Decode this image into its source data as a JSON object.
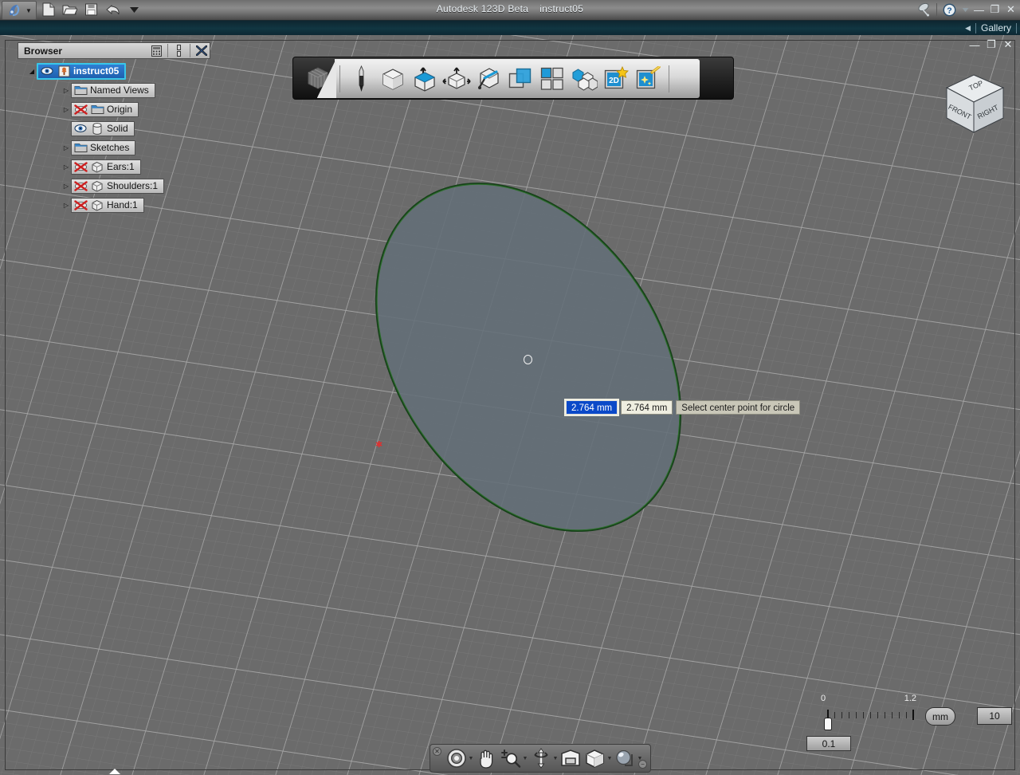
{
  "titlebar": {
    "app_title": "Autodesk 123D Beta",
    "document_name": "instruct05",
    "app_menu_icon": "app-logo-icon",
    "quick_access": [
      {
        "name": "new-document-icon",
        "label": "New"
      },
      {
        "name": "open-document-icon",
        "label": "Open"
      },
      {
        "name": "save-document-icon",
        "label": "Save"
      },
      {
        "name": "undo-icon",
        "label": "Undo"
      },
      {
        "name": "quick-access-more-icon",
        "label": "Customize"
      }
    ],
    "right_icons": [
      {
        "name": "satellite-dish-icon",
        "label": "Connect"
      },
      {
        "name": "help-icon",
        "label": "Help"
      },
      {
        "name": "help-dropdown-icon",
        "label": "Help options"
      }
    ],
    "window_controls": {
      "minimize": "—",
      "maximize": "❐",
      "close": "✕"
    }
  },
  "gallery_bar": {
    "arrow": "◀",
    "label": "Gallery"
  },
  "document_window_controls": {
    "minimize": "—",
    "restore": "❐",
    "close": "✕"
  },
  "browser": {
    "title": "Browser",
    "header_buttons": [
      {
        "name": "browser-grid-view-button",
        "glyph": "▒"
      },
      {
        "name": "browser-options-button",
        "glyph": "⋮"
      },
      {
        "name": "browser-close-button",
        "glyph": "✕"
      }
    ],
    "tree": [
      {
        "label": "instruct05",
        "selected": true,
        "twisty": "◢",
        "icons": [
          "eye-icon",
          "document-pin-icon"
        ],
        "indent": 0
      },
      {
        "label": "Named Views",
        "selected": false,
        "twisty": "▷",
        "icons": [
          "folder-icon"
        ],
        "indent": 1
      },
      {
        "label": "Origin",
        "selected": false,
        "twisty": "▷",
        "icons": [
          "hidden-x-icon",
          "folder-icon"
        ],
        "indent": 1
      },
      {
        "label": "Solid",
        "selected": false,
        "twisty": "",
        "icons": [
          "eye-icon",
          "cylinder-icon"
        ],
        "indent": 1
      },
      {
        "label": "Sketches",
        "selected": false,
        "twisty": "▷",
        "icons": [
          "folder-icon"
        ],
        "indent": 1
      },
      {
        "label": "Ears:1",
        "selected": false,
        "twisty": "▷",
        "icons": [
          "hidden-x-icon",
          "cube-icon"
        ],
        "indent": 1
      },
      {
        "label": "Shoulders:1",
        "selected": false,
        "twisty": "▷",
        "icons": [
          "hidden-x-icon",
          "cube-icon"
        ],
        "indent": 1
      },
      {
        "label": "Hand:1",
        "selected": false,
        "twisty": "▷",
        "icons": [
          "hidden-x-icon",
          "cube-icon"
        ],
        "indent": 1
      }
    ]
  },
  "toolbar": {
    "logo": "cube-logo-icon",
    "items": [
      {
        "name": "sketch-pencil-tool",
        "label": "Sketch"
      },
      {
        "name": "primitives-cube-tool",
        "label": "Primitives"
      },
      {
        "name": "construct-extrude-tool",
        "label": "Construct"
      },
      {
        "name": "modify-tool",
        "label": "Modify"
      },
      {
        "name": "pattern-sketch-tool",
        "label": "Pattern"
      },
      {
        "name": "combine-tool",
        "label": "Combine"
      },
      {
        "name": "grid-pattern-tool",
        "label": "Pattern Grid"
      },
      {
        "name": "assembly-cubes-tool",
        "label": "Assemble"
      },
      {
        "name": "2d-drawing-tool",
        "label": "2D",
        "badge": "star"
      },
      {
        "name": "smart-tool",
        "label": "Smart"
      }
    ]
  },
  "viewcube": {
    "faces": {
      "top": "TOP",
      "front": "FRONT",
      "right": "RIGHT"
    }
  },
  "canvas": {
    "measure_fields": [
      {
        "name": "diameter-input-active",
        "value": "2.764 mm",
        "active": true
      },
      {
        "name": "diameter-input-secondary",
        "value": "2.764 mm",
        "active": false
      }
    ],
    "hint": "Select center point for circle",
    "sketch_shape": "circle-on-sketch-plane",
    "cursor": "circle-cursor-icon",
    "origin_marker": "origin-point-marker"
  },
  "scale_ruler": {
    "min_label": "0",
    "max_label": "1.2",
    "slider_value": "0.1",
    "tick_count": 13
  },
  "units": {
    "unit_label": "mm",
    "zoom_value": "10"
  },
  "navbar": {
    "close_glyph": "✕",
    "minimize_glyph": "−",
    "items": [
      {
        "name": "orbit-tool",
        "label": "Orbit",
        "caret": true
      },
      {
        "name": "pan-tool",
        "label": "Pan",
        "caret": false
      },
      {
        "name": "zoom-tool",
        "label": "Zoom",
        "caret": true
      },
      {
        "name": "free-orbit-tool",
        "label": "Free Orbit",
        "caret": true
      },
      {
        "name": "look-at-tool",
        "label": "Look At",
        "caret": false
      },
      {
        "name": "display-mode-tool",
        "label": "Display",
        "caret": true
      },
      {
        "name": "visual-style-tool",
        "label": "Visual Style",
        "caret": true
      }
    ]
  },
  "colors": {
    "accent_blue": "#2f7fd4",
    "selection_border": "#39c6e8",
    "gallery_bg": "#113642",
    "measure_active_bg": "#0b49c8",
    "measure_bg": "#efeee0",
    "sketch_outline": "#1d4f1d",
    "viewport_bg": "#6b6b6b",
    "origin_red": "#e03030"
  }
}
